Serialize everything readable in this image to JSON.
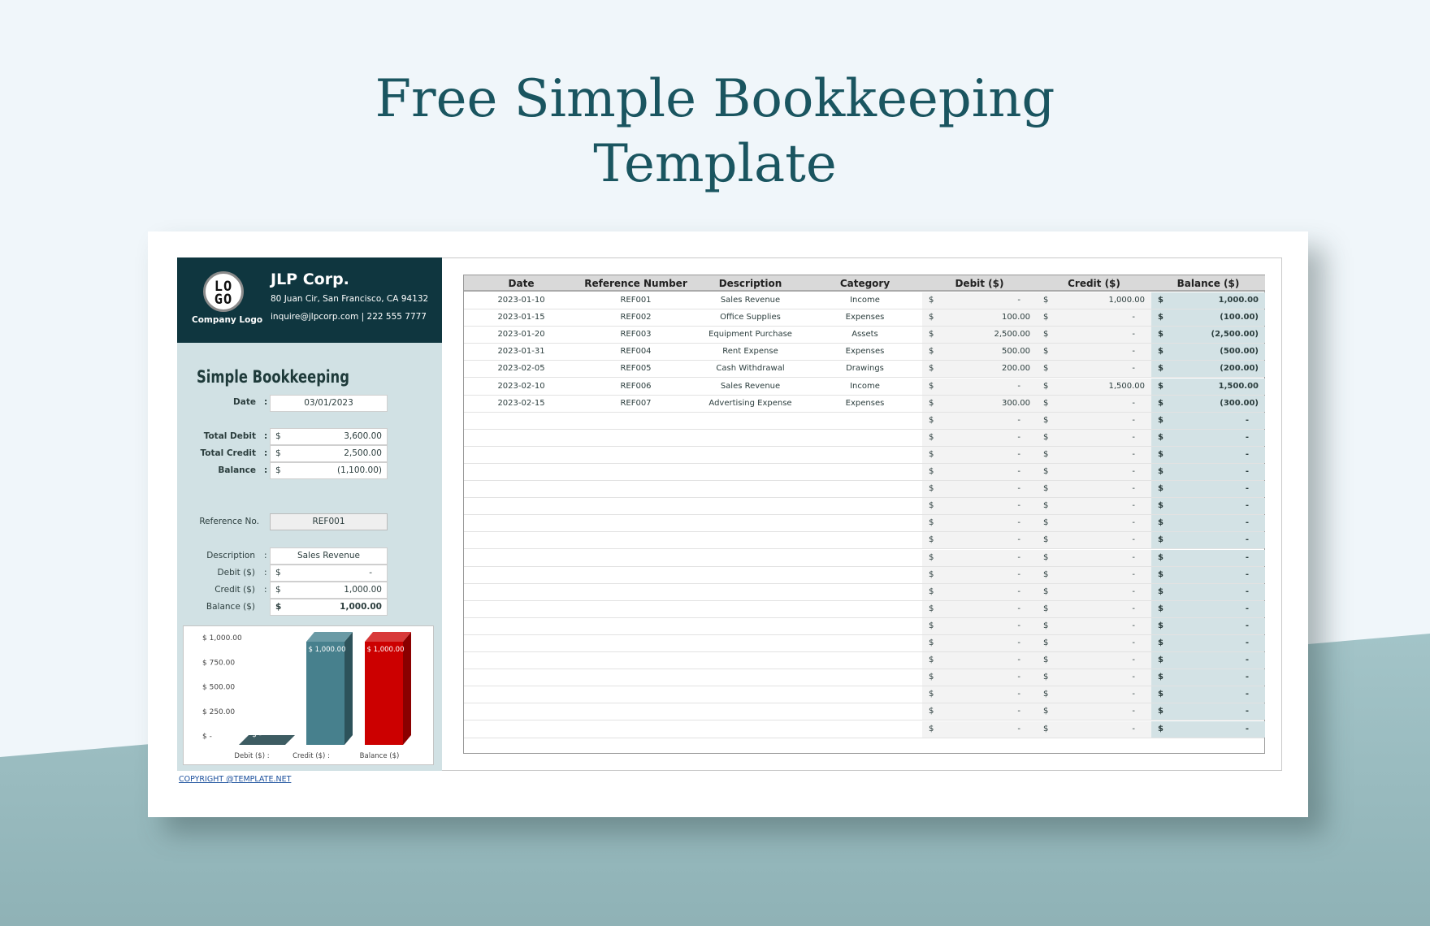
{
  "page_title": [
    "Free Simple Bookkeeping",
    "Template"
  ],
  "company": {
    "logo_text": [
      "LO",
      "GO"
    ],
    "logo_caption": "Company Logo",
    "name": "JLP Corp.",
    "address": "80 Juan Cir, San Francisco, CA 94132",
    "contact": "inquire@jlpcorp.com | 222 555 7777"
  },
  "summary": {
    "heading": "Simple Bookkeeping",
    "date_label": "Date",
    "date": "03/01/2023",
    "total_debit_label": "Total Debit",
    "total_debit": "3,600.00",
    "total_credit_label": "Total Credit",
    "total_credit": "2,500.00",
    "balance_label": "Balance",
    "balance": "(1,100.00)",
    "currency": "$"
  },
  "lookup": {
    "ref_label": "Reference No.",
    "ref": "REF001",
    "desc_label": "Description",
    "desc": "Sales Revenue",
    "debit_label": "Debit ($)",
    "debit": "-",
    "credit_label": "Credit ($)",
    "credit": "1,000.00",
    "balance_label": "Balance ($)",
    "balance": "1,000.00"
  },
  "chart_data": {
    "type": "bar",
    "categories": [
      "Debit ($)",
      "Credit ($)",
      "Balance ($)"
    ],
    "category_labels": [
      "Debit ($)   :",
      "Credit ($)   :",
      "Balance ($)"
    ],
    "values": [
      0,
      1000,
      1000
    ],
    "data_labels": [
      "$ -",
      "$ 1,000.00",
      "$ 1,000.00"
    ],
    "ylim": [
      0,
      1000
    ],
    "yticks": [
      "$ 1,000.00",
      "$ 750.00",
      "$ 500.00",
      "$ 250.00",
      "$ -"
    ],
    "colors": [
      "#3d5c62",
      "#47808d",
      "#cc0000"
    ]
  },
  "copyright": "COPYRIGHT @TEMPLATE.NET",
  "table": {
    "headers": [
      "Date",
      "Reference Number",
      "Description",
      "Category",
      "Debit ($)",
      "Credit ($)",
      "Balance ($)"
    ],
    "rows": [
      [
        "2023-01-10",
        "REF001",
        "Sales Revenue",
        "Income",
        "-",
        "1,000.00",
        "1,000.00"
      ],
      [
        "2023-01-15",
        "REF002",
        "Office Supplies",
        "Expenses",
        "100.00",
        "-",
        "(100.00)"
      ],
      [
        "2023-01-20",
        "REF003",
        "Equipment Purchase",
        "Assets",
        "2,500.00",
        "-",
        "(2,500.00)"
      ],
      [
        "2023-01-31",
        "REF004",
        "Rent Expense",
        "Expenses",
        "500.00",
        "-",
        "(500.00)"
      ],
      [
        "2023-02-05",
        "REF005",
        "Cash Withdrawal",
        "Drawings",
        "200.00",
        "-",
        "(200.00)"
      ],
      [
        "2023-02-10",
        "REF006",
        "Sales Revenue",
        "Income",
        "-",
        "1,500.00",
        "1,500.00"
      ],
      [
        "2023-02-15",
        "REF007",
        "Advertising Expense",
        "Expenses",
        "300.00",
        "-",
        "(300.00)"
      ],
      [
        "",
        "",
        "",
        "",
        "-",
        "-",
        "-"
      ],
      [
        "",
        "",
        "",
        "",
        "-",
        "-",
        "-"
      ],
      [
        "",
        "",
        "",
        "",
        "-",
        "-",
        "-"
      ],
      [
        "",
        "",
        "",
        "",
        "-",
        "-",
        "-"
      ],
      [
        "",
        "",
        "",
        "",
        "-",
        "-",
        "-"
      ],
      [
        "",
        "",
        "",
        "",
        "-",
        "-",
        "-"
      ],
      [
        "",
        "",
        "",
        "",
        "-",
        "-",
        "-"
      ],
      [
        "",
        "",
        "",
        "",
        "-",
        "-",
        "-"
      ],
      [
        "",
        "",
        "",
        "",
        "-",
        "-",
        "-"
      ],
      [
        "",
        "",
        "",
        "",
        "-",
        "-",
        "-"
      ],
      [
        "",
        "",
        "",
        "",
        "-",
        "-",
        "-"
      ],
      [
        "",
        "",
        "",
        "",
        "-",
        "-",
        "-"
      ],
      [
        "",
        "",
        "",
        "",
        "-",
        "-",
        "-"
      ],
      [
        "",
        "",
        "",
        "",
        "-",
        "-",
        "-"
      ],
      [
        "",
        "",
        "",
        "",
        "-",
        "-",
        "-"
      ],
      [
        "",
        "",
        "",
        "",
        "-",
        "-",
        "-"
      ],
      [
        "",
        "",
        "",
        "",
        "-",
        "-",
        "-"
      ],
      [
        "",
        "",
        "",
        "",
        "-",
        "-",
        "-"
      ],
      [
        "",
        "",
        "",
        "",
        "-",
        "-",
        "-"
      ]
    ]
  },
  "colors": {
    "header_dark": "#0f363f",
    "panel": "#d1e1e4",
    "title": "#1a5560",
    "balance_col": "#d3e2e5"
  }
}
